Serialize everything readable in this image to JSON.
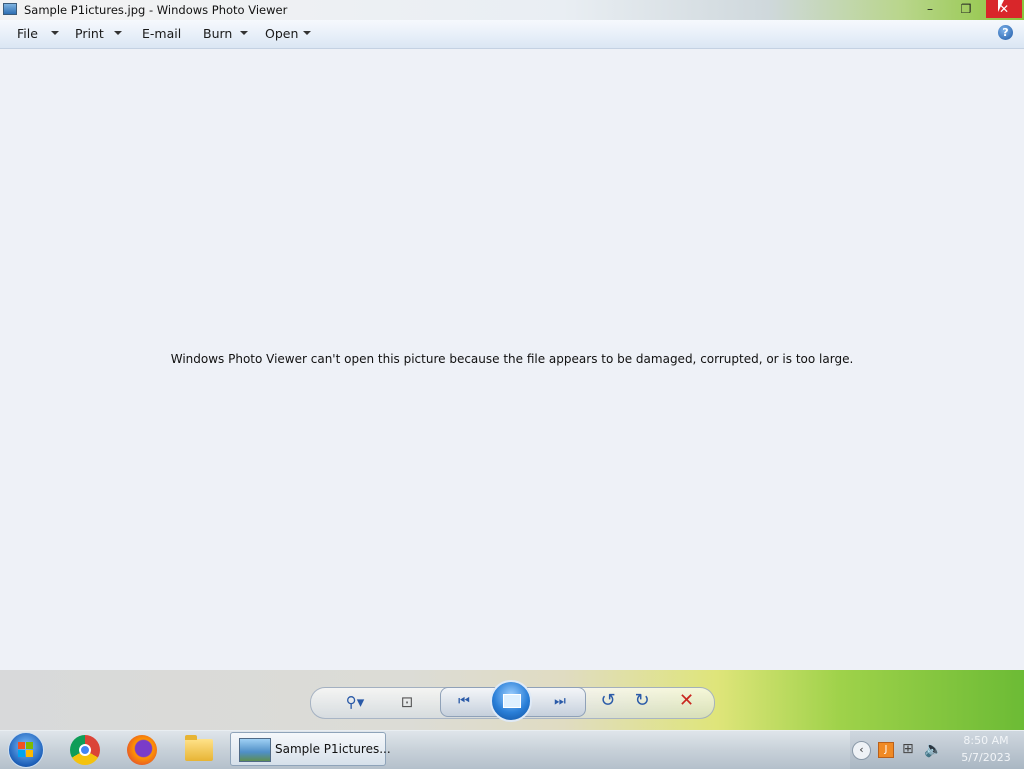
{
  "window": {
    "title": "Sample P1ictures.jpg - Windows Photo Viewer",
    "minimize_glyph": "–",
    "maximize_glyph": "❐",
    "close_glyph": "✕"
  },
  "menu": {
    "file": "File",
    "print": "Print",
    "email": "E-mail",
    "burn": "Burn",
    "open": "Open",
    "help_glyph": "?"
  },
  "content": {
    "error_message": "Windows Photo Viewer can't open this picture because the file appears to be damaged, corrupted, or is too large."
  },
  "controls": {
    "zoom_glyph": "⚲▾",
    "actual_size_glyph": "⊡",
    "previous_glyph": "⏮",
    "next_glyph": "⏭",
    "rotate_ccw_glyph": "↺",
    "rotate_cw_glyph": "↻",
    "delete_glyph": "✕"
  },
  "taskbar": {
    "window_label": "Sample P1ictures...",
    "tray_arrow": "‹",
    "time": "8:50 AM",
    "date": "5/7/2023"
  },
  "colors": {
    "close_button": "#d9262a",
    "content_background": "#eef1f7",
    "delete": "#c9261f"
  }
}
